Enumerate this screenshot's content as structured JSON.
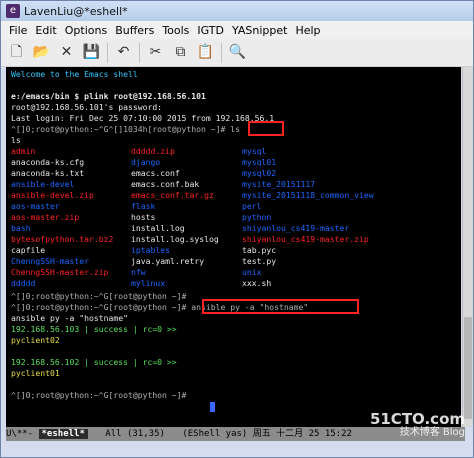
{
  "window": {
    "title": "LavenLiu@*eshell*"
  },
  "menu": [
    "File",
    "Edit",
    "Options",
    "Buffers",
    "Tools",
    "IGTD",
    "YASnippet",
    "Help"
  ],
  "toolbar": [
    "new-file-icon",
    "open-folder-icon",
    "close-icon",
    "save-icon",
    "undo-icon",
    "cut-icon",
    "copy-icon",
    "paste-icon",
    "search-icon"
  ],
  "terminal": {
    "lines": [
      {
        "text": "Welcome to the Emacs shell",
        "color": "welcome"
      },
      {
        "text": "",
        "color": "white"
      },
      {
        "text": "e:/emacs/bin $ plink root@192.168.56.101",
        "color": "white"
      },
      {
        "text": "root@192.168.56.101's password:",
        "color": "white"
      },
      {
        "text": "Last login: Fri Dec 25 07:10:00 2015 from 192.168.56.1",
        "color": "white"
      },
      {
        "text": "^[]0;root@python:~^G^[]1034h[root@python ~]# ls",
        "color": "prompt"
      },
      {
        "text": "ls",
        "color": "white"
      }
    ],
    "ls_rows": [
      [
        "admin",
        "ddddd.zip",
        "mysql",
        "red",
        "red",
        "blue"
      ],
      [
        "anaconda-ks.cfg",
        "django",
        "mysql01",
        "white",
        "blue",
        "blue"
      ],
      [
        "anaconda-ks.txt",
        "emacs.conf",
        "mysql02",
        "white",
        "white",
        "blue"
      ],
      [
        "ansible-devel",
        "emacs.conf.bak",
        "mysite_20151117",
        "blue",
        "white",
        "blue"
      ],
      [
        "ansible-devel.zip",
        "emacs_conf.tar.gz",
        "mysite_20151118_common_view",
        "red",
        "red",
        "blue"
      ],
      [
        "aos-master",
        "flask",
        "perl",
        "blue",
        "blue",
        "blue"
      ],
      [
        "aos-master.zip",
        "hosts",
        "python",
        "red",
        "white",
        "blue"
      ],
      [
        "bash",
        "install.log",
        "shiyanlou_cs419-master",
        "blue",
        "white",
        "blue"
      ],
      [
        "bytesofpython.tar.bz2",
        "install.log.syslog",
        "shiyanlou_cs419-master.zip",
        "red",
        "white",
        "red"
      ],
      [
        "capfile",
        "iptables",
        "tab.pyc",
        "white",
        "blue",
        "white"
      ],
      [
        "ChenngSSH-master",
        "java.yaml.retry",
        "test.py",
        "blue",
        "white",
        "white"
      ],
      [
        "ChenngSSH-master.zip",
        "nfw",
        "unix",
        "red",
        "blue",
        "blue"
      ],
      [
        "ddddd",
        "mylinux",
        "xxx.sh",
        "blue",
        "blue",
        "white"
      ]
    ],
    "after_ls": [
      {
        "text": "^[]0;root@python:~^G[root@python ~]#",
        "color": "prompt"
      },
      {
        "text": "^[]0;root@python:~^G[root@python ~]# ansible py -a \"hostname\"",
        "color": "prompt"
      },
      {
        "text": "ansible py -a \"hostname\"",
        "color": "white"
      },
      {
        "text": "192.168.56.103 | success | rc=0 >>",
        "color": "green"
      },
      {
        "text": "pyclient02",
        "color": "yellow"
      },
      {
        "text": "",
        "color": "white"
      },
      {
        "text": "192.168.56.102 | success | rc=0 >>",
        "color": "green"
      },
      {
        "text": "pyclient01",
        "color": "yellow"
      },
      {
        "text": "",
        "color": "white"
      },
      {
        "text": "^[]0;root@python:~^G[root@python ~]#",
        "color": "prompt"
      }
    ]
  },
  "modeline": {
    "state": "U\\**-",
    "buffer": "*eshell*",
    "position": "All (31,35)",
    "mode": "(EShell yas) 周五 十二月 25 15:22"
  },
  "watermark": {
    "line1": "51CTO.com",
    "line2": "技术博客 Blog"
  }
}
